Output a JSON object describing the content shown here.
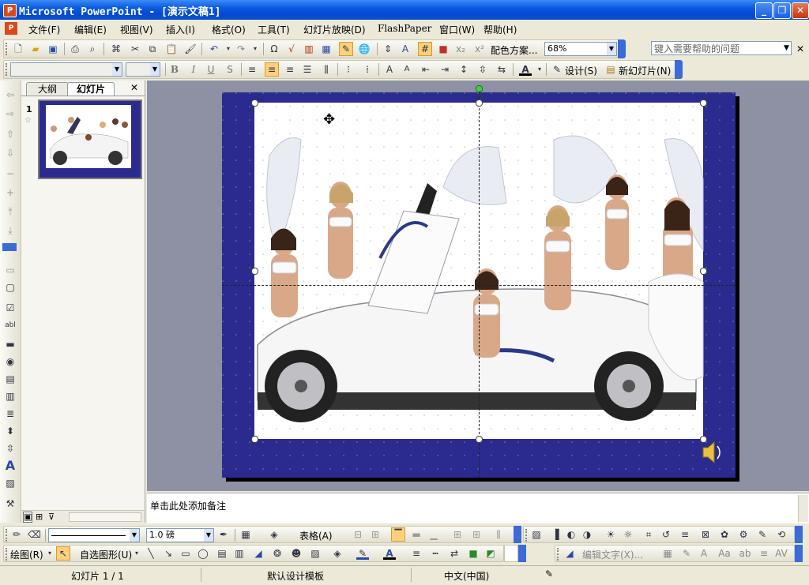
{
  "window": {
    "title": "Microsoft PowerPoint - [演示文稿1]",
    "app_icon": "P"
  },
  "menu": {
    "items": [
      "文件(F)",
      "编辑(E)",
      "视图(V)",
      "插入(I)",
      "格式(O)",
      "工具(T)",
      "幻灯片放映(D)",
      "FlashPaper",
      "窗口(W)",
      "帮助(H)"
    ],
    "help_placeholder": "键入需要帮助的问题",
    "close_glyph": "✕"
  },
  "standard_toolbar": {
    "color_scheme": "配色方案...",
    "zoom": "68%"
  },
  "format_toolbar": {
    "font": "",
    "size": "",
    "bold": "B",
    "italic": "I",
    "underline": "U",
    "shadow": "S",
    "design": "设计(S)",
    "new_slide": "新幻灯片(N)"
  },
  "pane": {
    "tab_outline": "大纲",
    "tab_slides": "幻灯片",
    "close": "✕",
    "slide_number": "1"
  },
  "notes": {
    "placeholder": "单击此处添加备注"
  },
  "drawing_toolbar": {
    "line_weight": "1.0 磅",
    "table": "表格(A)",
    "draw": "绘图(R)",
    "autoshapes": "自选图形(U)",
    "edit_text": "编辑文字(X)..."
  },
  "status": {
    "slide": "幻灯片 1 / 1",
    "template": "默认设计模板",
    "language": "中文(中国)"
  },
  "colors": {
    "titlebar": "#0a5ae0",
    "slide_bg": "#2b2b8f",
    "workspace": "#8d91a3",
    "accent": "#3c6ad8"
  },
  "slide": {
    "image": "sports-car-with-angel-models",
    "has_sound_icon": true
  }
}
